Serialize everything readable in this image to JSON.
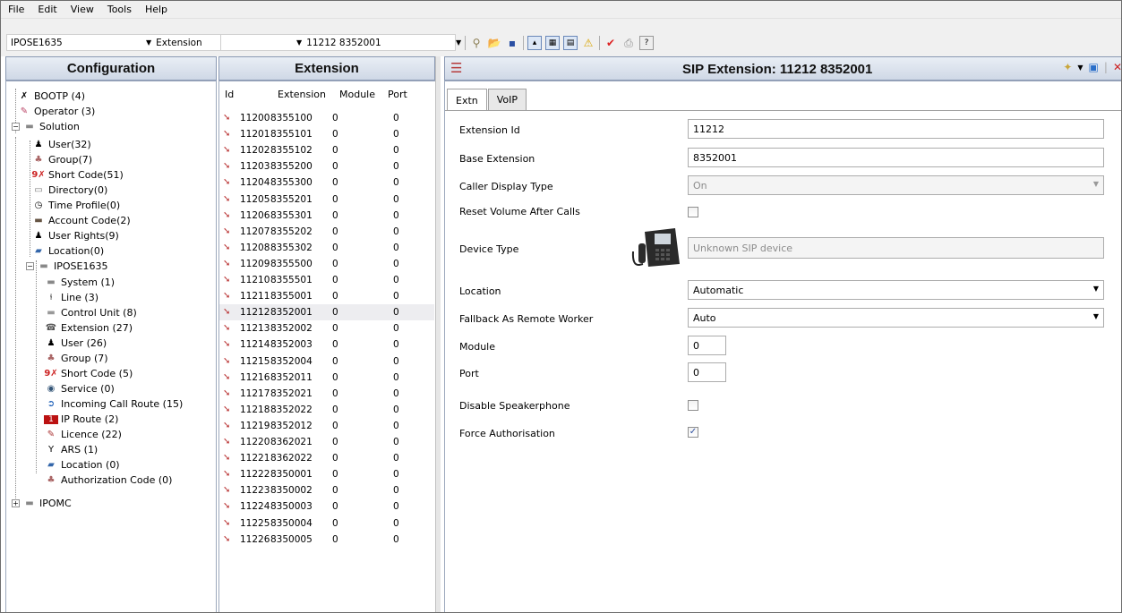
{
  "menu": [
    "File",
    "Edit",
    "View",
    "Tools",
    "Help"
  ],
  "toolbar": {
    "system_select": "IPOSE1635",
    "type_select": "Extension",
    "record_select": "11212 8352001"
  },
  "left_panel": {
    "title": "Configuration",
    "items": [
      {
        "label": "BOOTP (4)",
        "icon": "bootp-icon"
      },
      {
        "label": "Operator (3)",
        "icon": "operator-icon"
      },
      {
        "label": "Solution",
        "icon": "solution-icon"
      },
      {
        "label": "User(32)",
        "icon": "user-icon"
      },
      {
        "label": "Group(7)",
        "icon": "group-icon"
      },
      {
        "label": "Short Code(51)",
        "icon": "short-code-icon"
      },
      {
        "label": "Directory(0)",
        "icon": "directory-icon"
      },
      {
        "label": "Time Profile(0)",
        "icon": "time-profile-icon"
      },
      {
        "label": "Account Code(2)",
        "icon": "account-code-icon"
      },
      {
        "label": "User Rights(9)",
        "icon": "user-rights-icon"
      },
      {
        "label": "Location(0)",
        "icon": "location-icon"
      },
      {
        "label": "IPOSE1635",
        "icon": "system-icon"
      },
      {
        "label": "System (1)",
        "icon": "system-icon"
      },
      {
        "label": "Line (3)",
        "icon": "line-icon"
      },
      {
        "label": "Control Unit (8)",
        "icon": "control-unit-icon"
      },
      {
        "label": "Extension (27)",
        "icon": "extension-icon"
      },
      {
        "label": "User (26)",
        "icon": "user-icon"
      },
      {
        "label": "Group (7)",
        "icon": "group-icon"
      },
      {
        "label": "Short Code (5)",
        "icon": "short-code-icon"
      },
      {
        "label": "Service (0)",
        "icon": "service-icon"
      },
      {
        "label": "Incoming Call Route (15)",
        "icon": "incoming-call-route-icon"
      },
      {
        "label": "IP Route (2)",
        "icon": "ip-route-icon"
      },
      {
        "label": "Licence (22)",
        "icon": "licence-icon"
      },
      {
        "label": "ARS (1)",
        "icon": "ars-icon"
      },
      {
        "label": "Location (0)",
        "icon": "location-icon"
      },
      {
        "label": "Authorization Code (0)",
        "icon": "authorization-code-icon"
      },
      {
        "label": "IPOMC",
        "icon": "system-icon"
      }
    ]
  },
  "mid_panel": {
    "title": "Extension",
    "columns": [
      "Id",
      "Extension",
      "Module",
      "Port"
    ],
    "rows": [
      [
        "11200",
        "8355100",
        "0",
        "0"
      ],
      [
        "11201",
        "8355101",
        "0",
        "0"
      ],
      [
        "11202",
        "8355102",
        "0",
        "0"
      ],
      [
        "11203",
        "8355200",
        "0",
        "0"
      ],
      [
        "11204",
        "8355300",
        "0",
        "0"
      ],
      [
        "11205",
        "8355201",
        "0",
        "0"
      ],
      [
        "11206",
        "8355301",
        "0",
        "0"
      ],
      [
        "11207",
        "8355202",
        "0",
        "0"
      ],
      [
        "11208",
        "8355302",
        "0",
        "0"
      ],
      [
        "11209",
        "8355500",
        "0",
        "0"
      ],
      [
        "11210",
        "8355501",
        "0",
        "0"
      ],
      [
        "11211",
        "8355001",
        "0",
        "0"
      ],
      [
        "11212",
        "8352001",
        "0",
        "0"
      ],
      [
        "11213",
        "8352002",
        "0",
        "0"
      ],
      [
        "11214",
        "8352003",
        "0",
        "0"
      ],
      [
        "11215",
        "8352004",
        "0",
        "0"
      ],
      [
        "11216",
        "8352011",
        "0",
        "0"
      ],
      [
        "11217",
        "8352021",
        "0",
        "0"
      ],
      [
        "11218",
        "8352022",
        "0",
        "0"
      ],
      [
        "11219",
        "8352012",
        "0",
        "0"
      ],
      [
        "11220",
        "8362021",
        "0",
        "0"
      ],
      [
        "11221",
        "8362022",
        "0",
        "0"
      ],
      [
        "11222",
        "8350001",
        "0",
        "0"
      ],
      [
        "11223",
        "8350002",
        "0",
        "0"
      ],
      [
        "11224",
        "8350003",
        "0",
        "0"
      ],
      [
        "11225",
        "8350004",
        "0",
        "0"
      ],
      [
        "11226",
        "8350005",
        "0",
        "0"
      ]
    ],
    "selected_row": 12
  },
  "detail": {
    "title": "SIP Extension: 11212 8352001",
    "tabs": [
      "Extn",
      "VoIP"
    ],
    "active_tab": "Extn",
    "fields": {
      "extension_id": {
        "label": "Extension Id",
        "value": "11212"
      },
      "base_extension": {
        "label": "Base Extension",
        "value": "8352001"
      },
      "caller_display_type": {
        "label": "Caller Display Type",
        "value": "On"
      },
      "reset_volume": {
        "label": "Reset Volume After Calls",
        "checked": false
      },
      "device_type": {
        "label": "Device Type",
        "value": "Unknown SIP device"
      },
      "location": {
        "label": "Location",
        "value": "Automatic"
      },
      "fallback": {
        "label": "Fallback As Remote Worker",
        "value": "Auto"
      },
      "module": {
        "label": "Module",
        "value": "0"
      },
      "port": {
        "label": "Port",
        "value": "0"
      },
      "disable_speakerphone": {
        "label": "Disable Speakerphone",
        "checked": false
      },
      "force_authorisation": {
        "label": "Force Authorisation",
        "checked": true
      }
    }
  }
}
